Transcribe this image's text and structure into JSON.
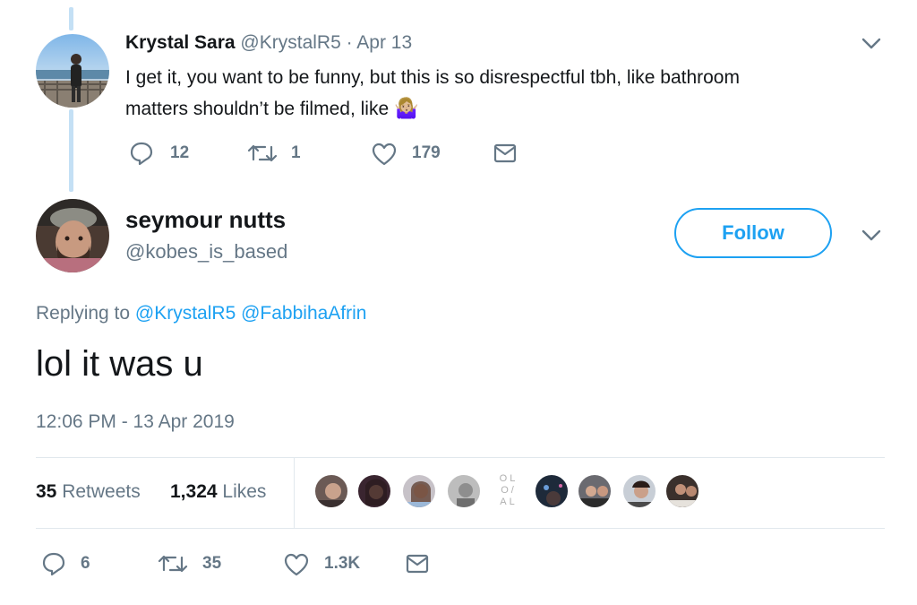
{
  "parent_tweet": {
    "display_name": "Krystal Sara",
    "handle": "@KrystalR5",
    "separator": "·",
    "date": "Apr 13",
    "text_line1": "I get it, you want to be funny, but this is so disrespectful tbh, like bathroom",
    "text_line2": "matters shouldn’t be filmed, like",
    "emoji": "🤷🏼‍♀️",
    "replies": "12",
    "retweets": "1",
    "likes": "179"
  },
  "main_tweet": {
    "display_name": "seymour nutts",
    "handle": "@kobes_is_based",
    "follow_label": "Follow",
    "replying_prefix": "Replying to",
    "reply_to_1": "@KrystalR5",
    "reply_to_2": "@FabbihaAfrin",
    "text": "lol it was u",
    "timestamp": "12:06 PM - 13 Apr 2019",
    "retweet_count": "35",
    "retweet_label": "Retweets",
    "like_count": "1,324",
    "like_label": "Likes",
    "replies": "6",
    "retweets": "35",
    "likes": "1.3K"
  },
  "likers_placeholder_text": [
    "OL",
    "O/",
    "AL"
  ],
  "colors": {
    "accent": "#1da1f2",
    "muted": "#657786",
    "thread_line": "#c4e0f5",
    "divider": "#e1e8ed"
  }
}
